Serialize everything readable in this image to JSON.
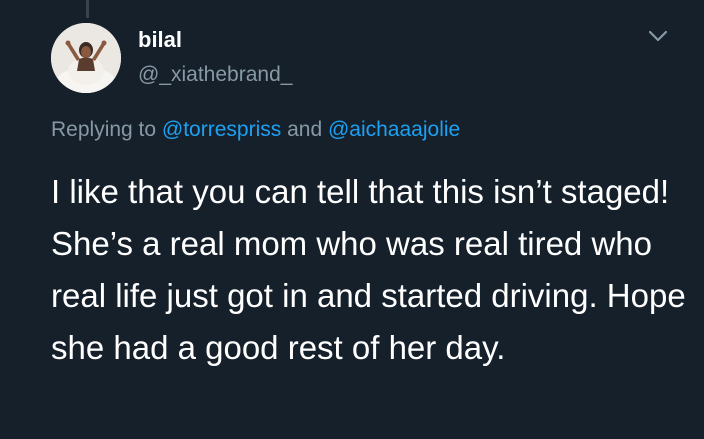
{
  "tweet": {
    "display_name": "bilal",
    "handle": "@_xiathebrand_",
    "replying_prefix": "Replying to ",
    "replying_mention_1": "@torrespriss",
    "replying_conjunction": " and ",
    "replying_mention_2": "@aichaaajolie",
    "text": "I like that you can tell that this isn’t staged! She’s a real mom who was real tired who real life just got in and started driving. Hope she had a good rest of her day."
  },
  "icons": {
    "avatar": "profile-photo",
    "menu": "chevron-down-icon"
  },
  "colors": {
    "background": "#15202b",
    "primary_text": "#ffffff",
    "secondary_text": "#8899a6",
    "link": "#1da1f2"
  }
}
